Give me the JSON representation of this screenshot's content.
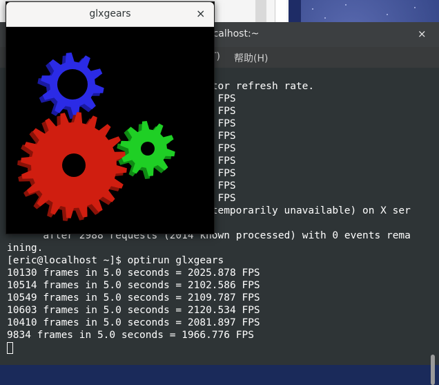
{
  "glxgears": {
    "title": "glxgears",
    "close_glyph": "×"
  },
  "terminal": {
    "title": "ocalhost:~",
    "close_glyph": "×",
    "menu": [
      "T)",
      "帮助(H)"
    ],
    "lines_partial_right": [
      "itor refresh rate.",
      "1 FPS",
      "2 FPS",
      "2 FPS",
      "2 FPS",
      "3 FPS",
      "1 FPS",
      "2 FPS",
      "2 FPS",
      "2 FPS",
      " temporarily unavailable) on X ser"
    ],
    "lines_full": [
      "      after 2988 requests (2014 known processed) with 0 events rema",
      "ining.",
      "[eric@localhost ~]$ optirun glxgears",
      "10130 frames in 5.0 seconds = 2025.878 FPS",
      "10514 frames in 5.0 seconds = 2102.586 FPS",
      "10549 frames in 5.0 seconds = 2109.787 FPS",
      "10603 frames in 5.0 seconds = 2120.534 FPS",
      "10410 frames in 5.0 seconds = 2081.897 FPS",
      "9834 frames in 5.0 seconds = 1966.776 FPS"
    ]
  },
  "gears": [
    {
      "color": "#2b2be6",
      "name": "blue-gear"
    },
    {
      "color": "#d01e10",
      "name": "red-gear"
    },
    {
      "color": "#1fcf25",
      "name": "green-gear"
    }
  ]
}
